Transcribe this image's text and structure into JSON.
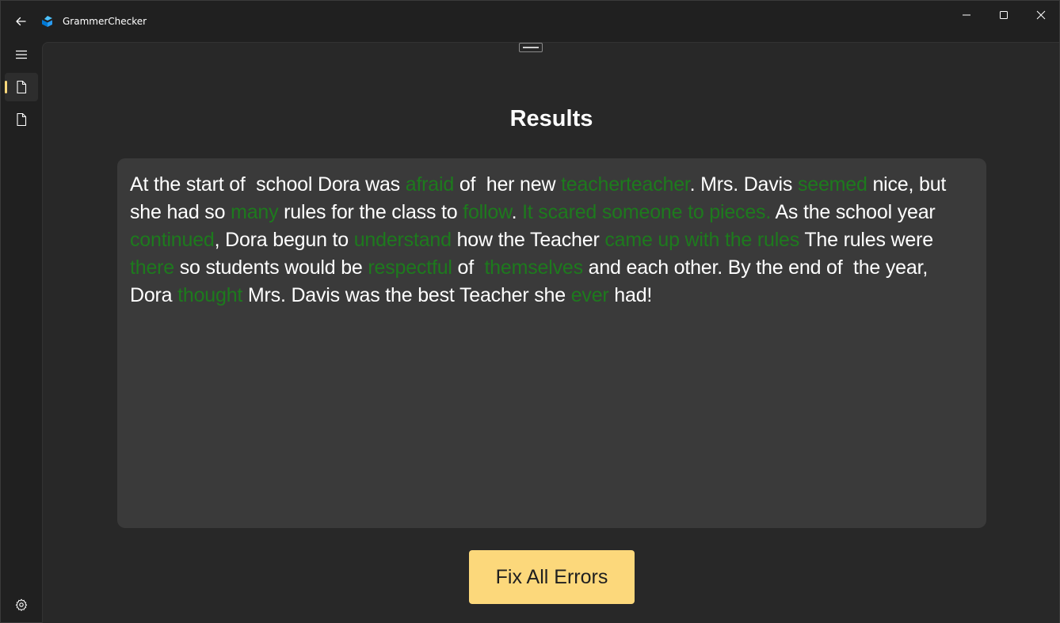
{
  "window": {
    "title": "GrammerChecker"
  },
  "colors": {
    "accent": "#fcd87b",
    "error_text": "#1d7a1d",
    "card_bg": "#3a3a3a",
    "content_bg": "#282828"
  },
  "nav": {
    "items": [
      {
        "name": "menu",
        "icon": "hamburger-icon"
      },
      {
        "name": "document-1",
        "icon": "document-icon",
        "selected": true
      },
      {
        "name": "document-2",
        "icon": "document-icon"
      },
      {
        "name": "settings",
        "icon": "gear-icon"
      }
    ]
  },
  "main": {
    "title": "Results",
    "segments": [
      {
        "text": "At the start of  school Dora was ",
        "error": false
      },
      {
        "text": "afraid",
        "error": true
      },
      {
        "text": " of  her new ",
        "error": false
      },
      {
        "text": "teacherteacher",
        "error": true
      },
      {
        "text": ". Mrs. Davis ",
        "error": false
      },
      {
        "text": "seemed",
        "error": true
      },
      {
        "text": " nice, but she had so ",
        "error": false
      },
      {
        "text": "many",
        "error": true
      },
      {
        "text": " rules for the class to ",
        "error": false
      },
      {
        "text": "follow",
        "error": true
      },
      {
        "text": ". ",
        "error": false
      },
      {
        "text": "It scared someone to pieces.",
        "error": true
      },
      {
        "text": " As the school year ",
        "error": false
      },
      {
        "text": "continued",
        "error": true
      },
      {
        "text": ", Dora begun to ",
        "error": false
      },
      {
        "text": "understand",
        "error": true
      },
      {
        "text": " how the Teacher ",
        "error": false
      },
      {
        "text": "came up with the rules",
        "error": true
      },
      {
        "text": " The rules were ",
        "error": false
      },
      {
        "text": "there",
        "error": true
      },
      {
        "text": " so students would be ",
        "error": false
      },
      {
        "text": "respectful",
        "error": true
      },
      {
        "text": " of  ",
        "error": false
      },
      {
        "text": "themselves",
        "error": true
      },
      {
        "text": " and each other. By the end of  the year, Dora ",
        "error": false
      },
      {
        "text": "thought",
        "error": true
      },
      {
        "text": " Mrs. Davis was the best Teacher she ",
        "error": false
      },
      {
        "text": "ever",
        "error": true
      },
      {
        "text": " had!",
        "error": false
      }
    ],
    "fix_button_label": "Fix All Errors"
  }
}
